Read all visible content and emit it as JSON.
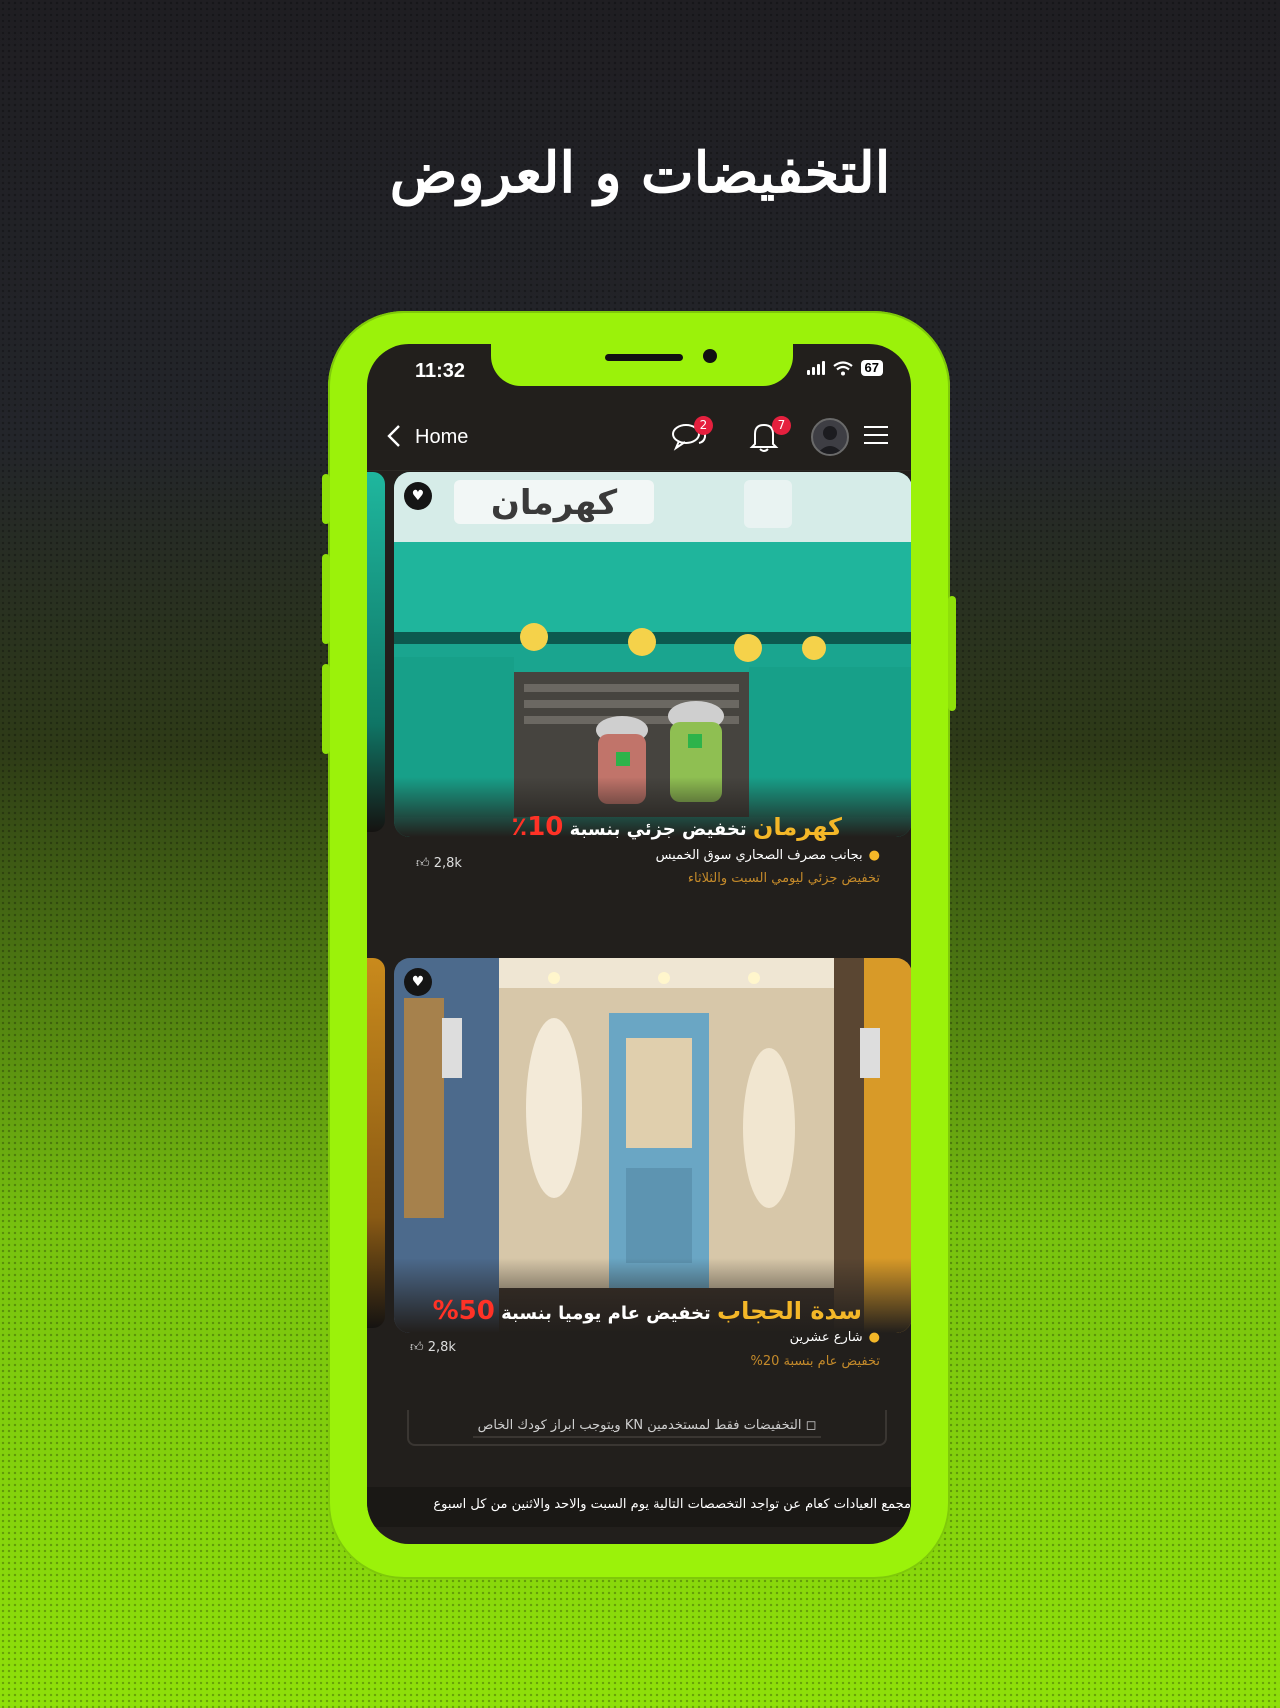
{
  "headline": "التخفيضات و العروض",
  "status_bar": {
    "time": "11:32",
    "battery": "67"
  },
  "navbar": {
    "back_label": "Home",
    "messages_count": "2",
    "notifications_count": "7"
  },
  "cards": [
    {
      "image_alt": "واجهة محل كهرمان",
      "sign_text": "كهرمان",
      "title_shop": "كهرمان",
      "title_text": "تخفيض جزئي بنسبة",
      "title_percent": "10٪",
      "location": "بجانب مصرف الصحاري سوق الخميس",
      "description": "تخفيض جزئي ليومي السبت والثلاثاء",
      "likes": "2,8k"
    },
    {
      "image_alt": "واجهة محل سدة الحجاب",
      "sign_text": "",
      "title_shop": "سدة الحجاب",
      "title_text": "تخفيض عام يوميا بنسبة",
      "title_percent": "50%",
      "location": "شارع عشرين",
      "description": "تخفيض عام بنسبة 20%",
      "likes": "2,8k"
    }
  ],
  "footer_note": "◻ التخفيضات فقط لمستخدمين KN ويتوجب ابراز كودك الخاص",
  "ticker": "مجمع العيادات كعام عن تواجد التخصصات التالية يوم السبت والاحد والاثنين من كل اسبوع",
  "colors": {
    "accent_green": "#9bf20a",
    "badge_red": "#e5203e",
    "shop_gold": "#f4b728",
    "percent_red": "#ff3226",
    "screen_bg": "#221f1c"
  },
  "icons": [
    "back-chevron-icon",
    "chat-icon",
    "bell-icon",
    "avatar-icon",
    "menu-icon",
    "heart-icon",
    "pin-icon",
    "thumbs-up-icon"
  ]
}
